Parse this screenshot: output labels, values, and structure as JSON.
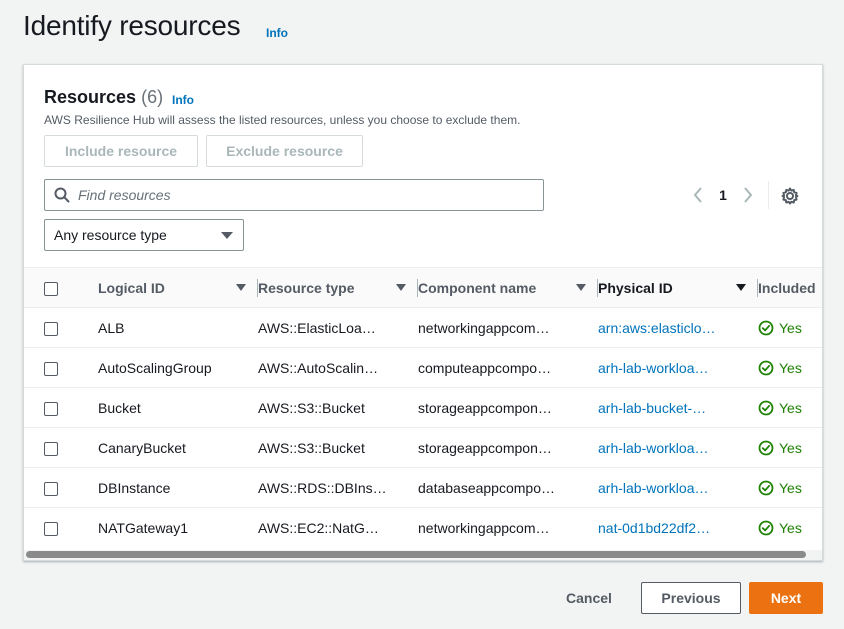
{
  "page": {
    "title": "Identify resources",
    "info_label": "Info"
  },
  "resources": {
    "title": "Resources",
    "count": "(6)",
    "info_label": "Info",
    "description": "AWS Resilience Hub will assess the listed resources, unless you choose to exclude them.",
    "include_button": "Include resource",
    "exclude_button": "Exclude resource",
    "search_placeholder": "Find resources",
    "search_value": "",
    "resource_type_filter": "Any resource type",
    "page_number": "1"
  },
  "table": {
    "columns": [
      "Logical ID",
      "Resource type",
      "Component name",
      "Physical ID",
      "Included"
    ],
    "rows": [
      {
        "logical_id": "ALB",
        "resource_type": "AWS::ElasticLoa…",
        "component": "networkingappcom…",
        "physical_id": "arn:aws:elasticlo…",
        "included": "Yes"
      },
      {
        "logical_id": "AutoScalingGroup",
        "resource_type": "AWS::AutoScalin…",
        "component": "computeappcompo…",
        "physical_id": "arh-lab-workloa…",
        "included": "Yes"
      },
      {
        "logical_id": "Bucket",
        "resource_type": "AWS::S3::Bucket",
        "component": "storageappcompon…",
        "physical_id": "arh-lab-bucket-…",
        "included": "Yes"
      },
      {
        "logical_id": "CanaryBucket",
        "resource_type": "AWS::S3::Bucket",
        "component": "storageappcompon…",
        "physical_id": "arh-lab-workloa…",
        "included": "Yes"
      },
      {
        "logical_id": "DBInstance",
        "resource_type": "AWS::RDS::DBIns…",
        "component": "databaseappcompo…",
        "physical_id": "arh-lab-workloa…",
        "included": "Yes"
      },
      {
        "logical_id": "NATGateway1",
        "resource_type": "AWS::EC2::NatG…",
        "component": "networkingappcom…",
        "physical_id": "nat-0d1bd22df2…",
        "included": "Yes"
      }
    ]
  },
  "footer": {
    "cancel": "Cancel",
    "previous": "Previous",
    "next": "Next"
  },
  "colors": {
    "accent_link": "#0073bb",
    "primary_button": "#ec7211",
    "success": "#1d8102"
  },
  "icons": [
    "search-icon",
    "chevron-left-icon",
    "chevron-right-icon",
    "settings-gear-icon",
    "caret-down-icon",
    "sort-caret-icon",
    "check-circle-icon"
  ]
}
